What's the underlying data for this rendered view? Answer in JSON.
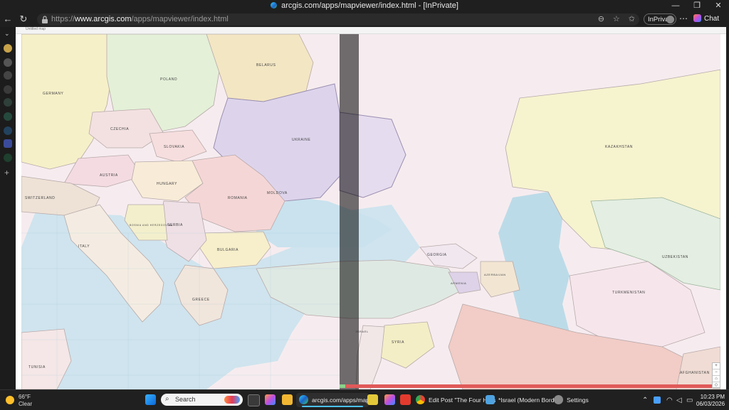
{
  "window": {
    "title": "arcgis.com/apps/mapviewer/index.html - [InPrivate]",
    "minimize_icon": "minimize-icon",
    "maximize_icon": "maximize-icon",
    "close_icon": "close-icon"
  },
  "browser": {
    "url_prefix": "https://",
    "url_domain": "www.arcgis.com",
    "url_path": "/apps/mapviewer/index.html",
    "inprivate_label": "InPrivate",
    "chat_label": "Chat"
  },
  "map": {
    "strip_text": "Untitled map",
    "countries": {
      "germany": "GERMANY",
      "poland": "POLAND",
      "belarus": "BELARUS",
      "ukraine": "UKRAINE",
      "czechia": "CZECHIA",
      "slovakia": "SLOVAKIA",
      "austria": "AUSTRIA",
      "hungary": "HUNGARY",
      "romania": "ROMANIA",
      "moldova": "MOLDOVA",
      "switzerland": "SWITZERLAND",
      "italy": "ITALY",
      "bosnia": "BOSNIA AND HERZEGOVINA",
      "serbia": "SERBIA",
      "bulgaria": "BULGARIA",
      "greece": "GREECE",
      "tunisia": "TUNISIA",
      "georgia": "GEORGIA",
      "armenia": "ARMENIA",
      "azerbaijan": "AZERBAIJAN",
      "kazakhstan": "KAZAKHSTAN",
      "uzbekistan": "UZBEKISTAN",
      "turkmenistan": "TURKMENISTAN",
      "syria": "SYRIA",
      "israel": "ISRAEL",
      "afghanistan": "AFGHANISTAN"
    },
    "control_icons": [
      "plus-icon",
      "minus-icon",
      "home-icon",
      "compass-icon"
    ]
  },
  "taskbar": {
    "weather_temp": "66°F",
    "weather_desc": "Clear",
    "search_placeholder": "Search",
    "apps": {
      "arcgis": "arcgis.com/apps/mapvi",
      "edit_post": "Edit Post \"The Four Hors",
      "israel": "*Israel (Modern Borders",
      "settings": "Settings"
    },
    "time": "10:23 PM",
    "date": "06/03/2026"
  }
}
